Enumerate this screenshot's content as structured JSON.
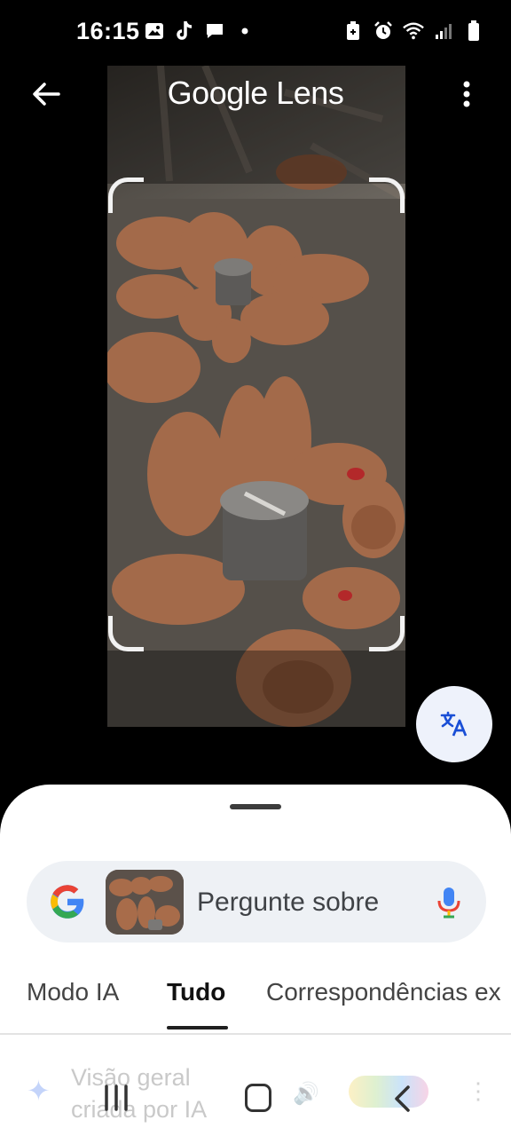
{
  "status_bar": {
    "time": "16:15",
    "left_icons": [
      "gallery-icon",
      "tiktok-icon",
      "chat-icon",
      "dot-icon"
    ],
    "right_icons": [
      "battery-saver-icon",
      "alarm-icon",
      "wifi-icon",
      "signal-icon",
      "battery-icon"
    ]
  },
  "header": {
    "title": "Google Lens",
    "back_icon": "arrow-left-icon",
    "menu_icon": "more-vert-icon"
  },
  "translate_button": {
    "icon": "translate-icon"
  },
  "search": {
    "query_label": "Pergunte sobre",
    "google_icon": "google-g-icon",
    "mic_icon": "mic-icon"
  },
  "tabs": [
    {
      "label": "Modo IA",
      "active": false
    },
    {
      "label": "Tudo",
      "active": true
    },
    {
      "label": "Correspondências ex",
      "active": false
    }
  ],
  "ai_overview": {
    "title": "Visão geral criada por IA"
  },
  "nav": {
    "recent_icon": "recent-apps-icon",
    "home_icon": "home-icon",
    "back_icon": "nav-back-icon"
  },
  "colors": {
    "background": "#000000",
    "sheet": "#ffffff",
    "search_bar": "#eef1f5",
    "translate_fab": "#eef2fb",
    "accent_blue": "#1a4fd6"
  }
}
